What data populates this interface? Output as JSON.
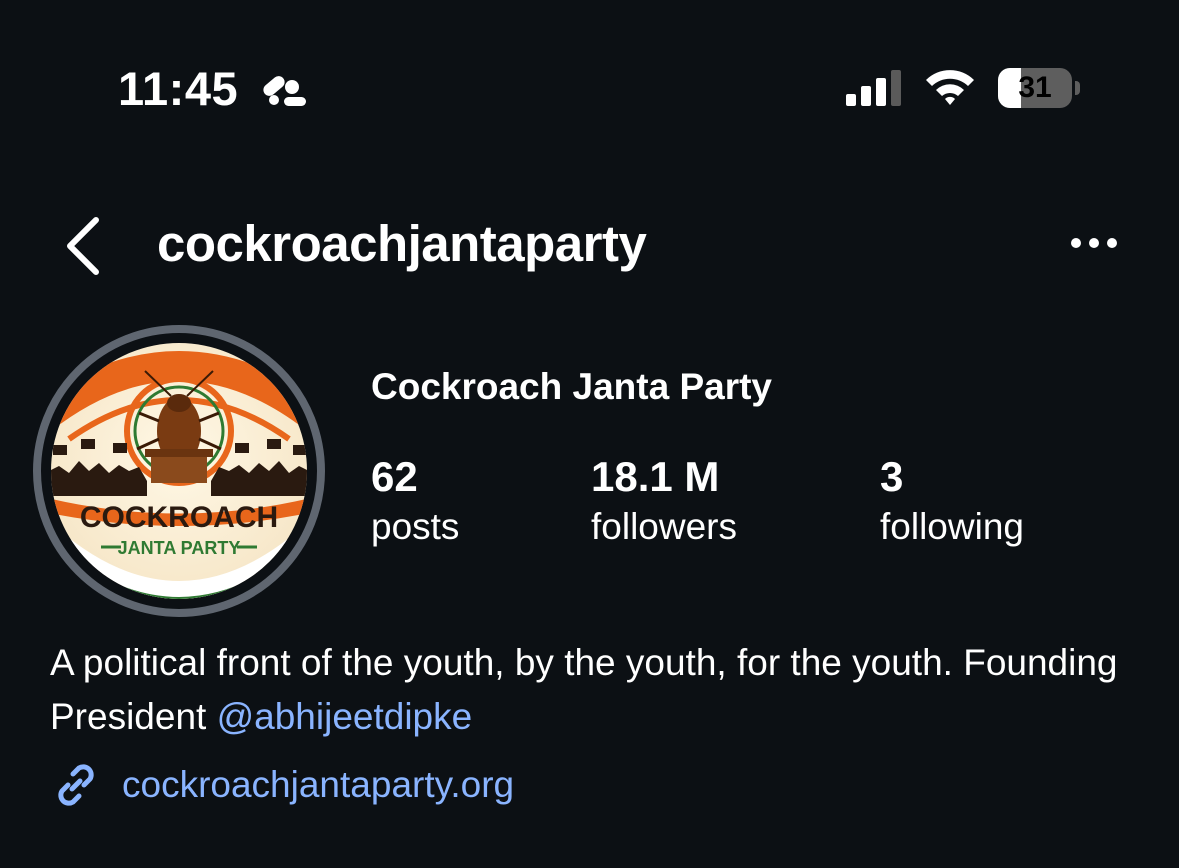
{
  "status_bar": {
    "time": "11:45",
    "focus_icon": "focus-mode-icon",
    "signal_icon": "cellular-signal-icon",
    "wifi_icon": "wifi-icon",
    "battery_level": "31",
    "battery_fraction": 0.31
  },
  "header": {
    "back_icon": "chevron-left-icon",
    "username": "cockroachjantaparty",
    "more_icon": "ellipsis-icon"
  },
  "profile": {
    "avatar_logo_text": [
      "COCKROACH",
      "JANTA PARTY"
    ],
    "display_name": "Cockroach Janta Party",
    "stats": {
      "posts": {
        "value": "62",
        "label": "posts"
      },
      "followers": {
        "value": "18.1 M",
        "label": "followers"
      },
      "following": {
        "value": "3",
        "label": "following"
      }
    },
    "bio": {
      "text": "A political front of the youth, by the youth, for the youth. Founding President ",
      "mention": "@abhijeetdipke"
    },
    "link": {
      "icon": "link-icon",
      "text": "cockroachjantaparty.org"
    }
  },
  "colors": {
    "background": "#0c1014",
    "text": "#ffffff",
    "link": "#8ab4ff",
    "avatar_ring": "#5f6670",
    "saffron": "#e8661b",
    "green": "#2f7a32",
    "cream": "#fbf1dc"
  }
}
